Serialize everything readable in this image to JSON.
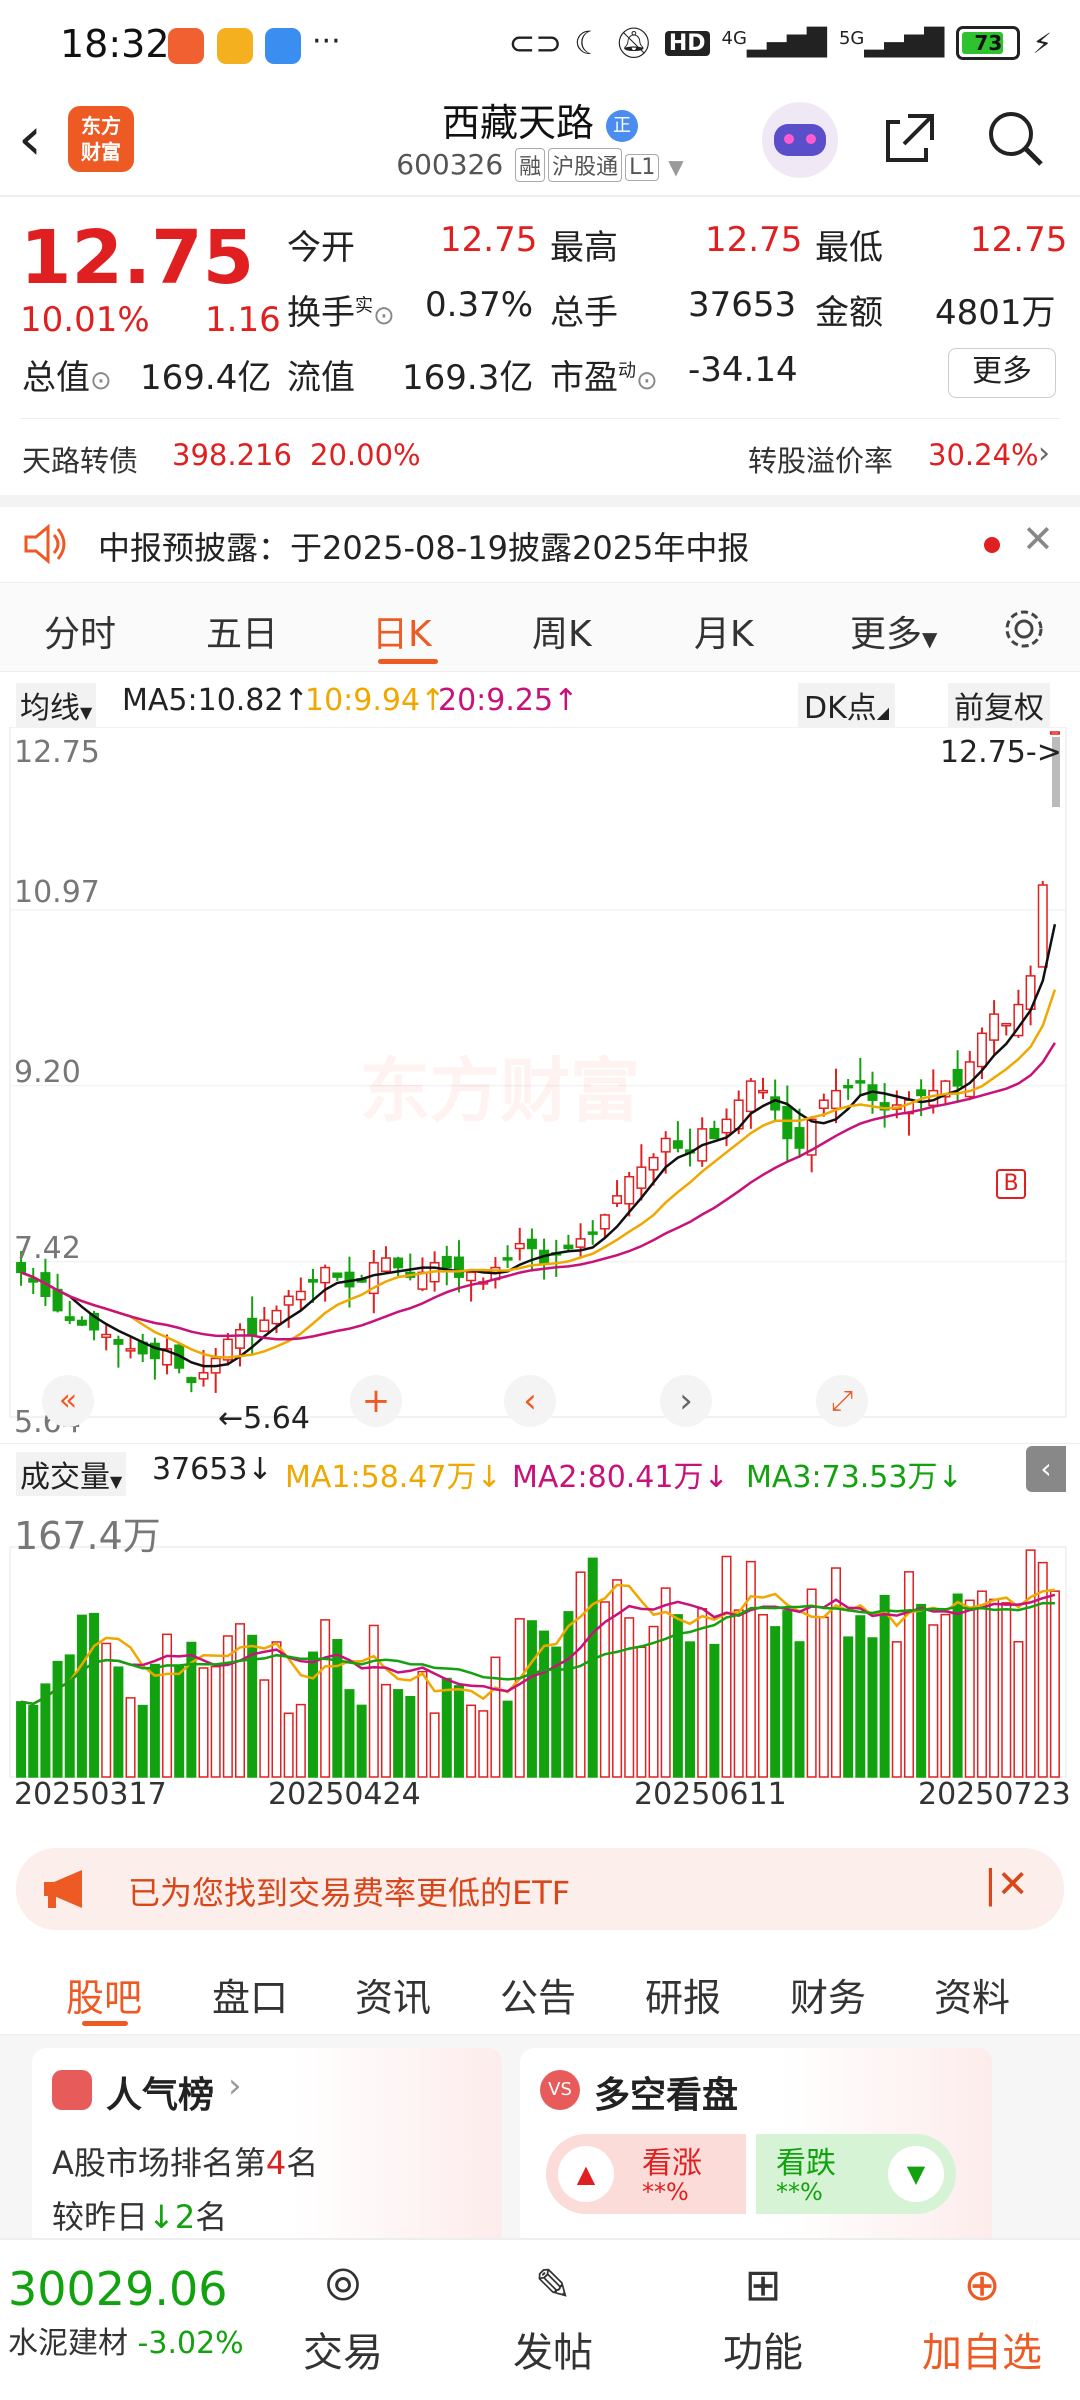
{
  "status_bar": {
    "time": "18:32",
    "more": "···",
    "signal1": "4G",
    "signal2": "5G",
    "hd": "HD",
    "battery": "73",
    "battery_level": 0.73
  },
  "header": {
    "logo_line1": "东方",
    "logo_line2": "财富",
    "name": "西藏天路",
    "badge": "正",
    "code": "600326",
    "tags": [
      "融",
      "沪股通",
      "L1"
    ]
  },
  "quote": {
    "price": "12.75",
    "change_pct": "10.01%",
    "change": "1.16",
    "open_label": "今开",
    "open": "12.75",
    "high_label": "最高",
    "high": "12.75",
    "low_label": "最低",
    "low": "12.75",
    "turnover_label": "换手",
    "turnover_sup": "实",
    "turnover": "0.37%",
    "volume_label": "总手",
    "volume": "37653",
    "amount_label": "金额",
    "amount": "4801万",
    "mktcap_label": "总值",
    "mktcap": "169.4亿",
    "float_label": "流值",
    "float": "169.3亿",
    "pe_label": "市盈",
    "pe_sup": "动",
    "pe": "-34.14",
    "more_label": "更多",
    "bond_name": "天路转债",
    "bond_price": "398.216",
    "bond_pct": "20.00%",
    "premium_label": "转股溢价率",
    "premium": "30.24%"
  },
  "notice": {
    "text": "中报预披露：于2025-08-19披露2025年中报"
  },
  "ktabs": [
    "分时",
    "五日",
    "日K",
    "周K",
    "月K",
    "更多"
  ],
  "active_ktab": 2,
  "ma_bar": {
    "select": "均线",
    "ma5": "MA5:10.82↑",
    "ma10": "10:9.94↑",
    "ma20": "20:9.25↑",
    "dk": "DK点",
    "adjust": "前复权"
  },
  "chart_labels": {
    "y_ticks": [
      "12.75",
      "10.97",
      "9.20",
      "7.42",
      "5.64"
    ],
    "price_marker": "12.75->",
    "low_marker": "5.64",
    "b_marker": "B",
    "watermark": "东方财富"
  },
  "vol_bar": {
    "select": "成交量",
    "vol": "37653↓",
    "ma1": "MA1:58.47万↓",
    "ma2": "MA2:80.41万↓",
    "ma3": "MA3:73.53万↓",
    "max": "167.4万"
  },
  "x_dates": [
    "20250317",
    "20250424",
    "20250611",
    "20250723"
  ],
  "etf": {
    "text": "已为您找到交易费率更低的ETF"
  },
  "subtabs": [
    "股吧",
    "盘口",
    "资讯",
    "公告",
    "研报",
    "财务",
    "资料"
  ],
  "cards": {
    "popular_title": "人气榜",
    "popular_line1_pre": "A股市场排名第",
    "popular_rank": "4",
    "popular_line1_post": "名",
    "popular_line2_pre": "较昨日",
    "popular_change": "2",
    "popular_line2_post": "名",
    "ls_title": "多空看盘",
    "up_label": "看涨",
    "up_val": "**%",
    "down_label": "看跌",
    "down_val": "**%"
  },
  "bottom_nav": {
    "index_value": "30029.06",
    "index_name": "水泥建材",
    "index_change": "-3.02%",
    "trade": "交易",
    "post": "发帖",
    "func": "功能",
    "add": "加自选"
  },
  "colors": {
    "up": "#e02020",
    "down": "#13a20f",
    "accent": "#ee5a24",
    "ma5": "#111111",
    "ma10": "#f0a800",
    "ma20": "#c8127a"
  },
  "chart_data": {
    "type": "candlestick",
    "y_axis": [
      5.64,
      12.75
    ],
    "closes": [
      7.1,
      7.0,
      6.85,
      6.7,
      6.6,
      6.55,
      6.5,
      6.45,
      6.35,
      6.3,
      6.25,
      6.2,
      6.3,
      6.1,
      5.95,
      6.05,
      6.2,
      6.4,
      6.5,
      6.45,
      6.6,
      6.7,
      6.85,
      6.9,
      7.0,
      7.15,
      7.05,
      6.95,
      7.0,
      7.2,
      7.25,
      7.15,
      7.05,
      7.1,
      7.2,
      7.15,
      7.05,
      7.1,
      7.0,
      7.15,
      7.25,
      7.4,
      7.35,
      7.2,
      7.3,
      7.35,
      7.45,
      7.5,
      7.7,
      7.9,
      8.1,
      8.2,
      8.3,
      8.5,
      8.4,
      8.35,
      8.6,
      8.5,
      8.7,
      8.9,
      9.1,
      9.0,
      8.8,
      8.5,
      8.4,
      8.7,
      8.9,
      9.0,
      9.05,
      9.1,
      8.9,
      8.8,
      8.85,
      8.9,
      8.95,
      9.0,
      9.1,
      9.05,
      9.3,
      9.6,
      9.8,
      9.7,
      9.9,
      10.2,
      11.15,
      12.75
    ]
  }
}
